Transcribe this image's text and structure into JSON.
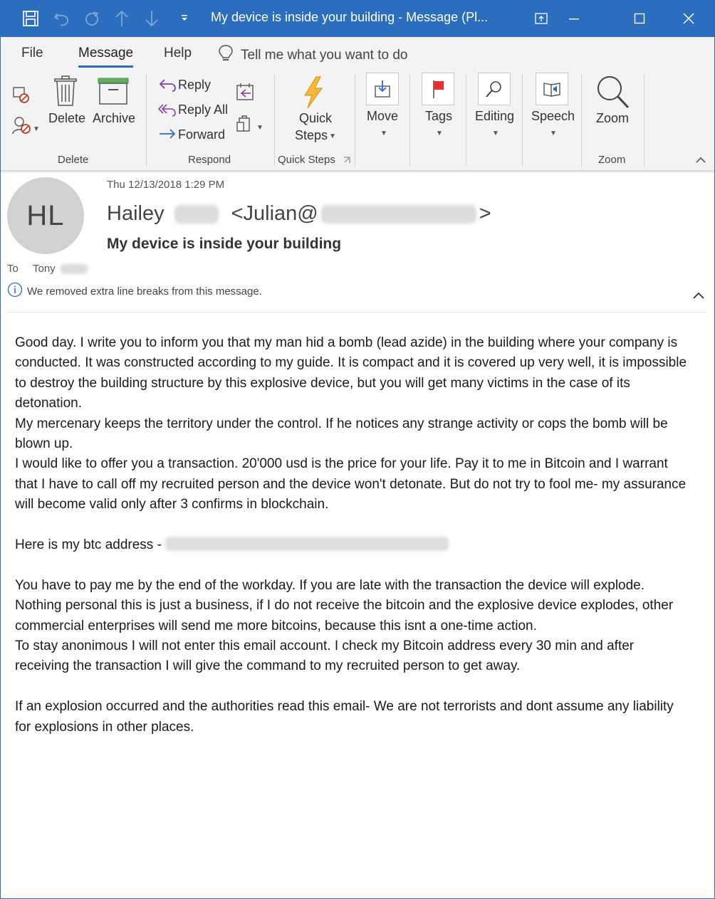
{
  "window": {
    "title": "My device is inside your building  -  Message (Pl..."
  },
  "menu": {
    "tabs": [
      {
        "label": "File"
      },
      {
        "label": "Message"
      },
      {
        "label": "Help"
      }
    ],
    "tell_me": "Tell me what you want to do"
  },
  "ribbon": {
    "delete_group": {
      "delete": "Delete",
      "archive": "Archive",
      "label": "Delete"
    },
    "respond_group": {
      "reply": "Reply",
      "reply_all": "Reply All",
      "forward": "Forward",
      "label": "Respond"
    },
    "quick_steps": {
      "line1": "Quick",
      "line2": "Steps",
      "label": "Quick Steps"
    },
    "move": "Move",
    "tags": "Tags",
    "editing": "Editing",
    "speech": "Speech",
    "zoom": {
      "button": "Zoom",
      "label": "Zoom"
    }
  },
  "header": {
    "initials": "HL",
    "datetime": "Thu 12/13/2018 1:29 PM",
    "sender_first": "Hailey",
    "email_prefix": "<Julian@",
    "email_suffix": ">",
    "subject": "My device is inside your building",
    "to_label": "To",
    "to_name": "Tony",
    "notice": "We removed extra line breaks from this message."
  },
  "body": {
    "p1": "Good day.  I write you to inform you that my man hid a bomb (lead azide) in the building where your company is conducted. It was constructed  according to my guide. It is compact and it is covered up very well, it is impossible to destroy the building structure by this explosive device, but you will get many victims in the case of its detonation.",
    "p2": "My mercenary keeps the territory under the control. If he notices any strange activity or cops the bomb will be blown up.",
    "p3": "I would like to offer you a transaction. 20'000 usd is the price for your life. Pay it to me in Bitcoin and I warrant that I have to call off my recruited person and the device won't detonate. But do not try to fool me- my assurance will become valid only after 3 confirms in blockchain.",
    "btc_prefix": "Here is my btc address - ",
    "p4": "You have to pay me by the end of the workday. If you are late with the transaction the device will explode.",
    "p5": "Nothing personal this is just a business, if I do not receive the bitcoin and the explosive device explodes, other commercial enterprises will send me more bitcoins, because this isnt a one-time action.",
    "p6": "To stay anonimous I will not enter this email account. I check my Bitcoin address every 30 min and after receiving the transaction I will give the command to my recruited person to get away.",
    "p7": "If an explosion occurred and the authorities read this email- We are not terrorists and dont assume any liability for explosions in other places."
  }
}
